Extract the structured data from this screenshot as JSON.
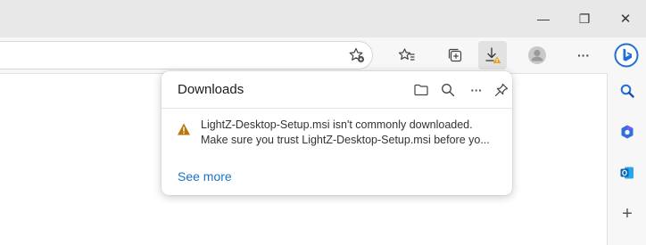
{
  "window": {
    "minimize_glyph": "—",
    "restore_glyph": "❐",
    "close_glyph": "✕"
  },
  "toolbar": {
    "more_glyph": "···",
    "icons": [
      "add-favorite-icon",
      "favorites-icon",
      "collections-icon",
      "downloads-icon",
      "profile-icon",
      "more-icon",
      "bing-icon"
    ]
  },
  "downloads_flyout": {
    "title": "Downloads",
    "more_glyph": "···",
    "item": {
      "line1": "LightZ-Desktop-Setup.msi isn't commonly downloaded.",
      "line2": "Make sure you trust LightZ-Desktop-Setup.msi before yo..."
    },
    "see_more": "See more"
  },
  "sidebar": {
    "icons": [
      "search-icon",
      "shopping-icon",
      "outlook-icon",
      "add-icon"
    ],
    "add_glyph": "+"
  },
  "colors": {
    "accent": "#1a73c8",
    "warning": "#c8860a",
    "bing_blue": "#1f6fd6"
  }
}
